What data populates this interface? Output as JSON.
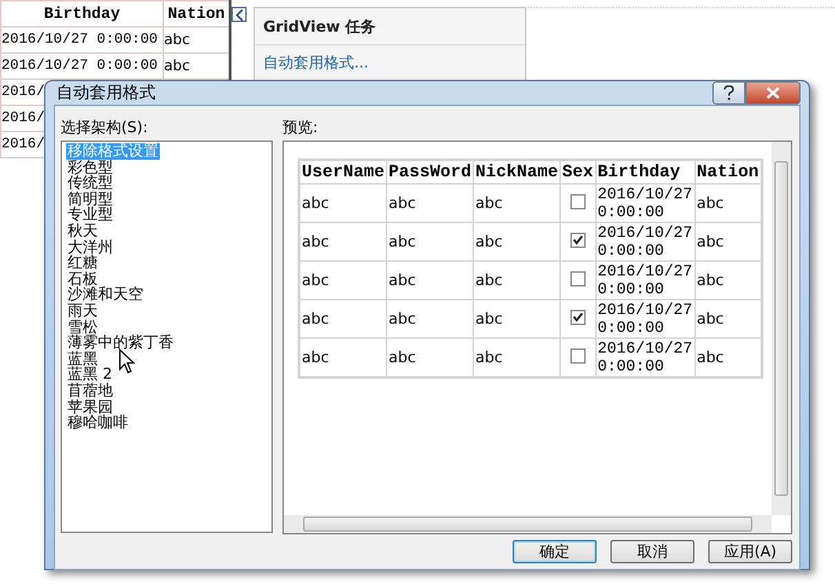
{
  "background_grid": {
    "columns": [
      "Birthday",
      "Nation"
    ],
    "rows": [
      {
        "cells": [
          "2016/10/27 0:00:00",
          "abc"
        ]
      },
      {
        "cells": [
          "2016/10/27 0:00:00",
          "abc"
        ]
      },
      {
        "cells": [
          "2016/"
        ]
      },
      {
        "cells": [
          "2016/"
        ]
      },
      {
        "cells": [
          "2016/"
        ]
      }
    ]
  },
  "tasks_panel": {
    "title": "GridView 任务",
    "link": "自动套用格式..."
  },
  "dialog": {
    "title": "自动套用格式",
    "scheme_label": "选择架构(S):",
    "schemes": [
      {
        "label": "移除格式设置",
        "selected": true
      },
      {
        "label": "彩色型",
        "selected": false
      },
      {
        "label": "传统型",
        "selected": false
      },
      {
        "label": "简明型",
        "selected": false
      },
      {
        "label": "专业型",
        "selected": false
      },
      {
        "label": "秋天",
        "selected": false
      },
      {
        "label": "大洋州",
        "selected": false
      },
      {
        "label": "红糖",
        "selected": false
      },
      {
        "label": "石板",
        "selected": false
      },
      {
        "label": "沙滩和天空",
        "selected": false
      },
      {
        "label": "雨天",
        "selected": false
      },
      {
        "label": "雪松",
        "selected": false
      },
      {
        "label": "薄雾中的紫丁香",
        "selected": false
      },
      {
        "label": "蓝黑",
        "selected": false
      },
      {
        "label": "蓝黑 2",
        "selected": false
      },
      {
        "label": "苜蓿地",
        "selected": false
      },
      {
        "label": "苹果园",
        "selected": false
      },
      {
        "label": "穆哈咖啡",
        "selected": false
      }
    ],
    "preview_label": "预览:",
    "preview_table": {
      "columns": [
        "UserName",
        "PassWord",
        "NickName",
        "Sex",
        "Birthday",
        "Nation"
      ],
      "rows": [
        {
          "username": "abc",
          "password": "abc",
          "nickname": "abc",
          "sex_checked": false,
          "birthday": "2016/10/27 0:00:00",
          "nation": "abc"
        },
        {
          "username": "abc",
          "password": "abc",
          "nickname": "abc",
          "sex_checked": true,
          "birthday": "2016/10/27 0:00:00",
          "nation": "abc"
        },
        {
          "username": "abc",
          "password": "abc",
          "nickname": "abc",
          "sex_checked": false,
          "birthday": "2016/10/27 0:00:00",
          "nation": "abc"
        },
        {
          "username": "abc",
          "password": "abc",
          "nickname": "abc",
          "sex_checked": true,
          "birthday": "2016/10/27 0:00:00",
          "nation": "abc"
        },
        {
          "username": "abc",
          "password": "abc",
          "nickname": "abc",
          "sex_checked": false,
          "birthday": "2016/10/27 0:00:00",
          "nation": "abc"
        }
      ]
    },
    "buttons": [
      {
        "label": "确定",
        "default": true
      },
      {
        "label": "取消",
        "default": false
      },
      {
        "label": "应用(A)",
        "default": false
      }
    ]
  }
}
